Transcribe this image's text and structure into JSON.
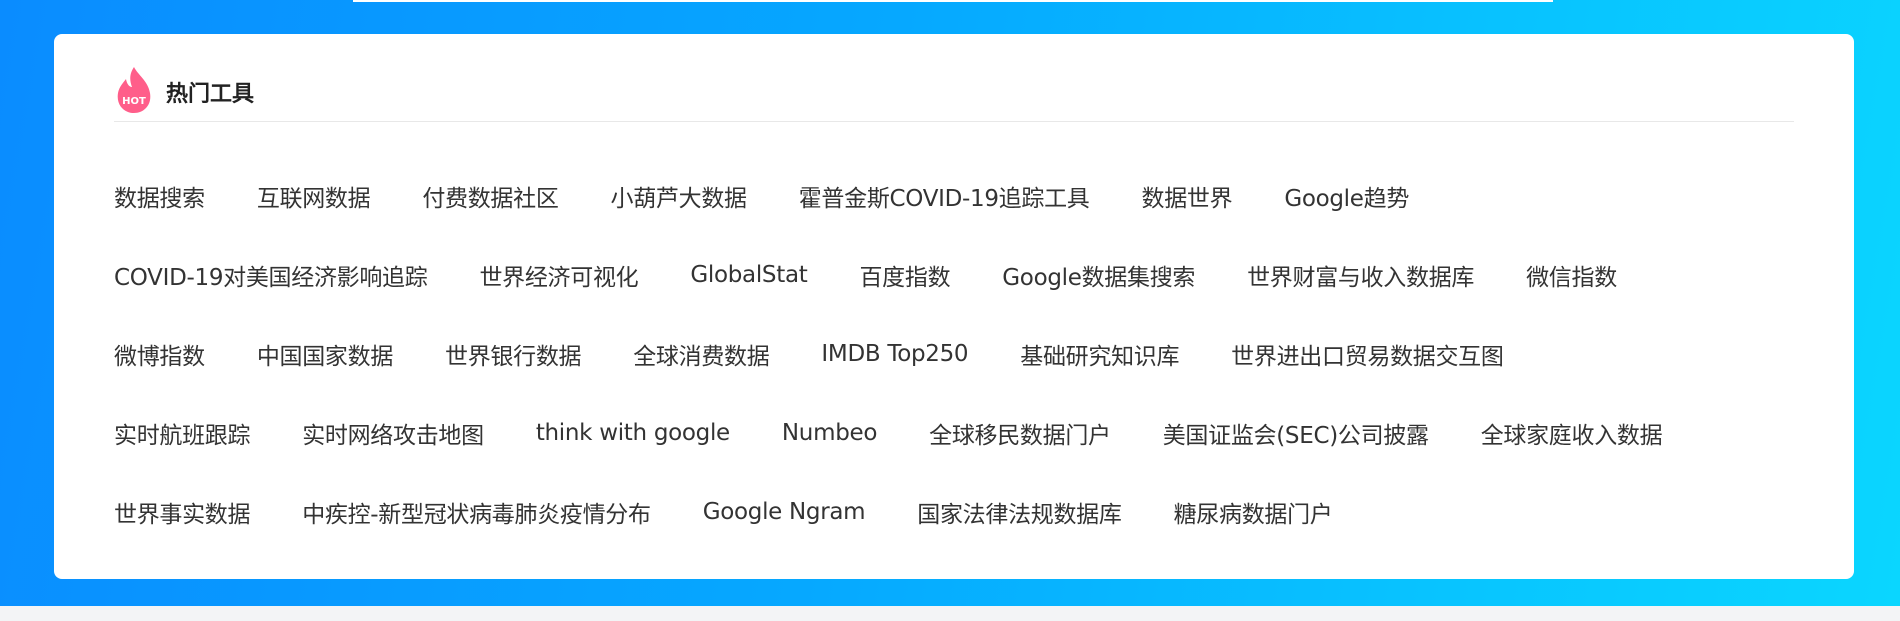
{
  "section": {
    "title": "热门工具",
    "icon": "hot-flame-icon",
    "icon_text": "HOT"
  },
  "colors": {
    "accent_gradient_start": "#0a8cff",
    "accent_gradient_end": "#0ad6ff",
    "hot_icon": "#ff5e8a",
    "text": "#333333"
  },
  "tools": [
    [
      "数据搜索",
      "互联网数据",
      "付费数据社区",
      "小葫芦大数据",
      "霍普金斯COVID-19追踪工具",
      "数据世界",
      "Google趋势"
    ],
    [
      "COVID-19对美国经济影响追踪",
      "世界经济可视化",
      "GlobalStat",
      "百度指数",
      "Google数据集搜索",
      "世界财富与收入数据库",
      "微信指数"
    ],
    [
      "微博指数",
      "中国国家数据",
      "世界银行数据",
      "全球消费数据",
      "IMDB Top250",
      "基础研究知识库",
      "世界进出口贸易数据交互图"
    ],
    [
      "实时航班跟踪",
      "实时网络攻击地图",
      "think with google",
      "Numbeo",
      "全球移民数据门户",
      "美国证监会(SEC)公司披露",
      "全球家庭收入数据"
    ],
    [
      "世界事实数据",
      "中疾控-新型冠状病毒肺炎疫情分布",
      "Google Ngram",
      "国家法律法规数据库",
      "糖尿病数据门户"
    ]
  ]
}
